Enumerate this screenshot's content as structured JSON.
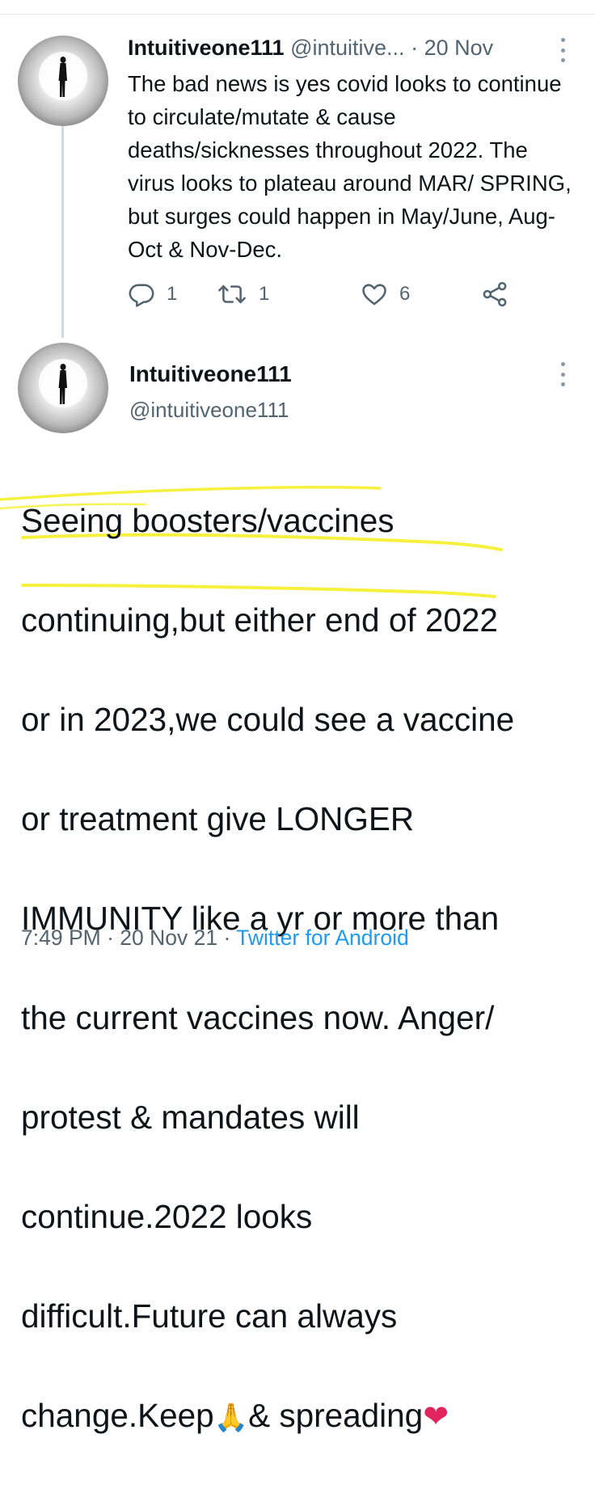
{
  "tweet1": {
    "display_name": "Intuitiveone111",
    "handle": "@intuitive...",
    "separator": " · ",
    "date": "20 Nov",
    "text": "The bad news is yes covid looks to continue to circulate/mutate & cause deaths/sicknesses throughout 2022. The virus looks to plateau around MAR/ SPRING, but surges could happen in May/June, Aug-Oct & Nov-Dec.",
    "reply_count": "1",
    "retweet_count": "1",
    "like_count": "6"
  },
  "tweet2": {
    "display_name": "Intuitiveone111",
    "handle": "@intuitiveone111",
    "text_lines": [
      "Seeing boosters/vaccines",
      "continuing,but either end of 2022",
      "or in 2023,we could see a vaccine",
      "or treatment give LONGER",
      "IMMUNITY like a yr or more than",
      "the current vaccines now. Anger/",
      "protest & mandates will",
      "continue.2022 looks",
      "difficult.Future can always",
      "change.Keep",
      "& spreading"
    ],
    "emoji_pray": "🙏",
    "emoji_heart": "❤",
    "time": "7:49 PM",
    "separator": " · ",
    "date": "20 Nov 21",
    "source": "Twitter for Android"
  },
  "colors": {
    "text": "#0f1419",
    "muted": "#536471",
    "link": "#1d9bf0",
    "highlight": "#f5f02a",
    "heart": "#e0245e"
  },
  "icons": {
    "reply": "reply-icon",
    "retweet": "retweet-icon",
    "like": "heart-icon",
    "share": "share-icon",
    "more": "more-vertical-icon"
  }
}
